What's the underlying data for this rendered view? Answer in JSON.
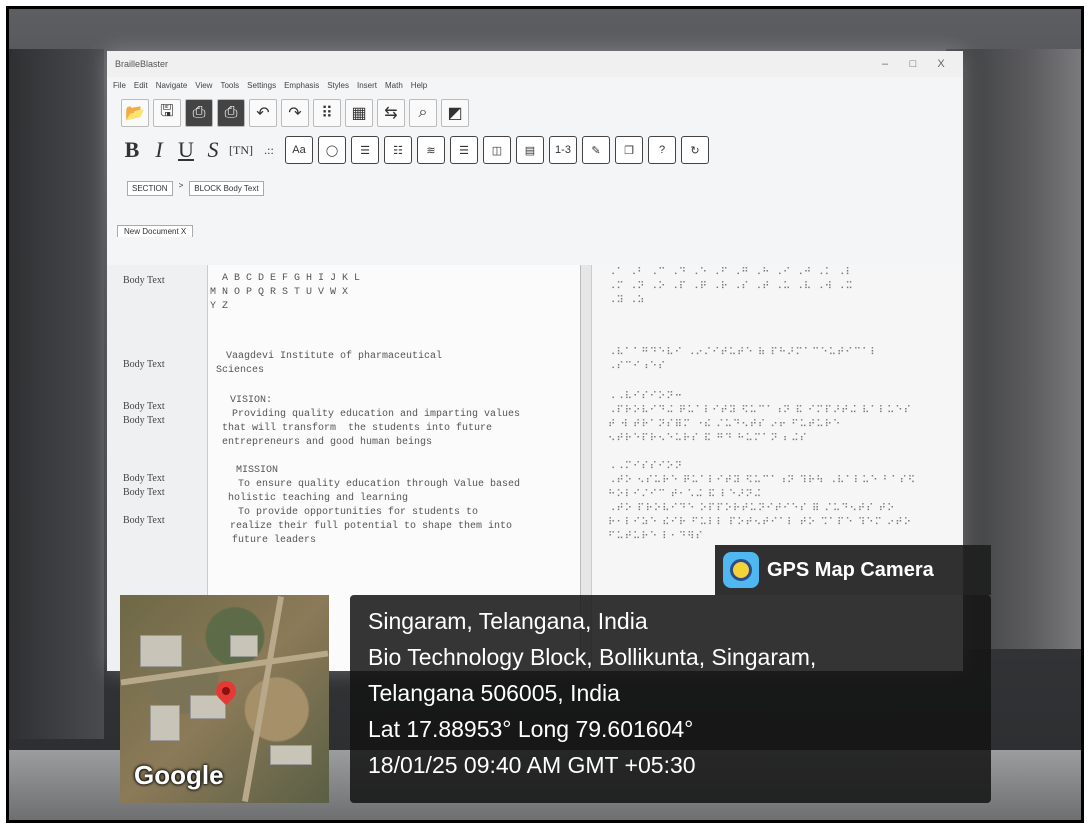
{
  "app": {
    "title": "BrailleBlaster",
    "window_controls": [
      "–",
      "□",
      "X"
    ],
    "menu": [
      "File",
      "Edit",
      "Navigate",
      "View",
      "Tools",
      "Settings",
      "Emphasis",
      "Styles",
      "Insert",
      "Math",
      "Help"
    ],
    "toolbar_icons": [
      "open-icon",
      "save-as-icon",
      "print-icon",
      "emboss-icon",
      "undo-icon",
      "redo-icon",
      "braille-preview-icon",
      "table-icon",
      "translate-icon",
      "find-icon",
      "image-describer-icon"
    ],
    "format_buttons": {
      "bold": "B",
      "italic": "I",
      "underline": "U",
      "script": "S",
      "tn": "[TN]",
      "braille_symbol": ".::",
      "aa": "Aa",
      "range": "1-3"
    },
    "breadcrumb": {
      "section": "SECTION",
      "sep": ">",
      "block": "BLOCK Body Text"
    },
    "tab": {
      "label": "New Document",
      "close": "X"
    }
  },
  "editor": {
    "style_labels": [
      "Body Text",
      "Body Text",
      "Body Text",
      "Body Text",
      "Body Text",
      "Body Text",
      "Body Text"
    ],
    "print_lines": [
      "A B C D E F G H I J K L",
      "M N O P Q R S T U V W X",
      "Y Z",
      "Vaagdevi Institute of pharmaceutical",
      "Sciences",
      "VISION:",
      "Providing quality education and imparting values",
      "that will transform  the students into future",
      "entrepreneurs and good human beings",
      "MISSION",
      "To ensure quality education through Value based",
      "holistic teaching and learning",
      "To provide opportunities for students to",
      "realize their full potential to shape them into",
      "future leaders"
    ],
    "braille_lines": [
      "⠠⠁ ⠠⠃ ⠠⠉ ⠠⠙ ⠠⠑ ⠠⠋ ⠠⠛ ⠠⠓ ⠠⠊ ⠠⠚ ⠠⠅ ⠠⠇",
      "⠠⠍ ⠠⠝ ⠠⠕ ⠠⠏ ⠠⠟ ⠠⠗ ⠠⠎ ⠠⠞ ⠠⠥ ⠠⠧ ⠠⠺ ⠠⠭",
      "⠠⠽ ⠠⠵",
      "⠠⠧⠁⠁⠛⠙⠑⠧⠊ ⠠⠔⠌⠊⠞⠥⠞⠑ ⠷ ⠏⠓⠜⠍⠁⠉⠑⠥⠞⠊⠉⠁⠇",
      "⠠⠎⠉⠊⠰⠑⠎",
      "⠠⠠⠧⠊⠎⠊⠕⠝⠒",
      "⠠⠏⠗⠕⠧⠊⠙⠬ ⠟⠥⠁⠇⠊⠞⠽ ⠫⠥⠉⠁⠰⠝ ⠯ ⠊⠍⠏⠜⠞⠬ ⠧⠁⠇⠥⠑⠎",
      "⠞ ⠺ ⠞⠗⠁⠝⠎⠿⠍ ⠐⠮ ⠌⠥⠙⠢⠞⠎ ⠔⠖ ⠋⠥⠞⠥⠗⠑",
      "⠢⠞⠗⠑⠏⠗⠢⠑⠥⠗⠎ ⠯ ⠛⠙ ⠓⠥⠍⠁⠝ ⠆⠬⠎",
      "⠠⠠⠍⠊⠎⠎⠊⠕⠝",
      "⠠⠞⠕ ⠢⠎⠥⠗⠑ ⠟⠥⠁⠇⠊⠞⠽ ⠫⠥⠉⠁⠰⠝ ⠹⠗⠳ ⠠⠧⠁⠇⠥⠑ ⠃⠁⠎⠫",
      "⠓⠕⠇⠊⠌⠊⠉ ⠞⠂⠡⠬ ⠯ ⠇⠑⠜⠝⠬",
      "⠠⠞⠕ ⠏⠗⠕⠧⠊⠙⠑ ⠕⠏⠏⠕⠗⠞⠥⠝⠊⠞⠊⠑⠎ ⠿ ⠌⠥⠙⠢⠞⠎ ⠞⠕",
      "⠗⠂⠇⠊⠵⠑ ⠮⠊⠗ ⠋⠥⠇⠇ ⠏⠕⠞⠢⠞⠊⠁⠇ ⠞⠕ ⠩⠁⠏⠑ ⠹⠑⠍ ⠔⠞⠕",
      "⠋⠥⠞⠥⠗⠑ ⠇⠂⠙⠻⠎"
    ]
  },
  "gps": {
    "app_name": "GPS Map Camera",
    "place": "Singaram, Telangana, India",
    "address_line1": "Bio Technology Block, Bollikunta, Singaram,",
    "address_line2": "Telangana 506005, India",
    "coords": "Lat 17.88953° Long 79.601604°",
    "timestamp": "18/01/25 09:40 AM GMT +05:30",
    "map_brand": "Google"
  }
}
